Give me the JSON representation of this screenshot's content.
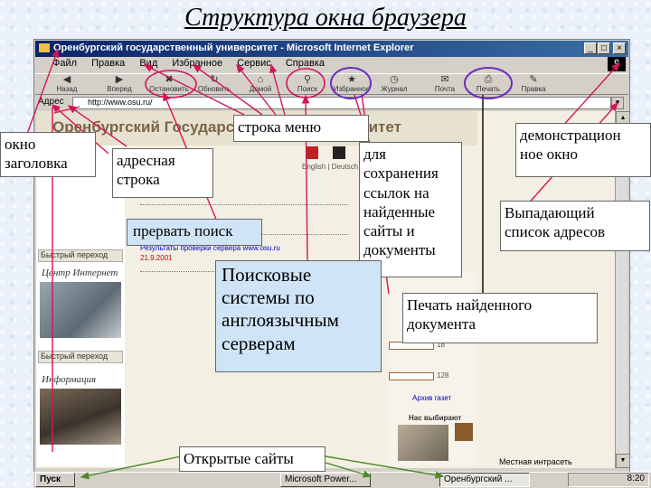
{
  "slide_title": "Структура окна браузера",
  "window": {
    "title": "Оренбургский государственный университет - Microsoft Internet Explorer",
    "controls": [
      "_",
      "□",
      "×"
    ]
  },
  "menu": {
    "items": [
      "Файл",
      "Правка",
      "Вид",
      "Избранное",
      "Сервис",
      "Справка"
    ]
  },
  "toolbar": {
    "buttons": [
      {
        "label": "Назад",
        "icon": "back-arrow-icon"
      },
      {
        "label": "Вперед",
        "icon": "forward-arrow-icon"
      },
      {
        "label": "Остановить",
        "icon": "stop-icon"
      },
      {
        "label": "Обновить",
        "icon": "refresh-icon"
      },
      {
        "label": "Домой",
        "icon": "home-icon"
      },
      {
        "label": "Поиск",
        "icon": "search-icon"
      },
      {
        "label": "Избранное",
        "icon": "favorites-icon"
      },
      {
        "label": "Журнал",
        "icon": "history-icon"
      },
      {
        "label": "Почта",
        "icon": "mail-icon"
      },
      {
        "label": "Печать",
        "icon": "print-icon"
      },
      {
        "label": "Правка",
        "icon": "edit-icon"
      }
    ]
  },
  "address": {
    "label": "Адрес",
    "value": "http://www.osu.ru/"
  },
  "page": {
    "banner": "Оренбургский Государственный Университет",
    "lang_links": "English | Deutsch",
    "side_select_1": "Быстрый переход",
    "side_head_1": "Центр Интернет",
    "side_select_2": "Быстрый переход",
    "side_head_2": "Информация",
    "news_link": "Результаты проверки сервера www.osu.ru",
    "news_date": "21.9.2001",
    "right_values": [
      "18",
      "128"
    ],
    "right_link": "Архив газет",
    "right_link_2": "Нас выбирают"
  },
  "status": {
    "zone": "Местная интрасеть"
  },
  "taskbar": {
    "start": "Пуск",
    "tasks": [
      "Microsoft Power...",
      "Оренбургский ..."
    ],
    "clock": "8:20"
  },
  "callouts": {
    "window_title": "окно\nзаголовка",
    "address_bar": "адресная\nстрока",
    "menu_bar": "строка меню",
    "stop_search": "прервать поиск",
    "favorites": "для\nсохранения\nссылок на\nнайденные\nсайты и\nдокументы",
    "search_engines": "Поисковые\nсистемы по\nанглоязычным\nсерверам",
    "print": "Печать найденного\nдокумента",
    "demo_window": "демонстрацион\nное окно",
    "address_list": "Выпадающий\nсписок адресов",
    "open_sites": "Открытые сайты"
  },
  "colors": {
    "arrow": "#d4145a",
    "ring": "#6a2cc0",
    "title_bar": "#0a246a",
    "open_sites_arrow": "#4c8a2a"
  }
}
